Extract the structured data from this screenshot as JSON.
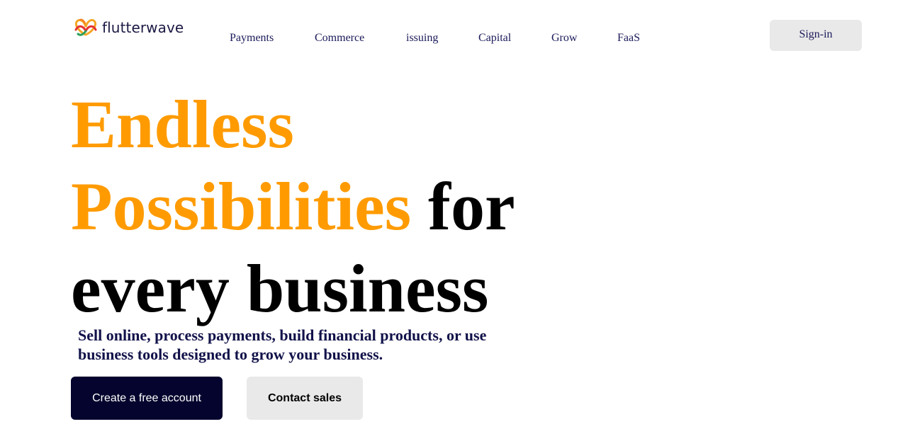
{
  "brand": {
    "name": "flutterwave",
    "logo_icon": "flutterwave-butterfly-logo",
    "colors": {
      "orange": "#ff9b00",
      "navy": "#04042e",
      "nav_text": "#1b1a5a",
      "light_button": "#e9e9e9"
    }
  },
  "nav": {
    "items": [
      {
        "label": "Payments"
      },
      {
        "label": "Commerce"
      },
      {
        "label": "issuing"
      },
      {
        "label": "Capital"
      },
      {
        "label": "Grow"
      },
      {
        "label": "FaaS"
      }
    ],
    "signin_label": "Sign-in"
  },
  "hero": {
    "line1": "Endless",
    "line2_highlight": "Possibilities",
    "line2_rest": "for",
    "line3": "every business",
    "subtitle": "Sell online, process payments, build financial products, or use business tools designed to grow your business."
  },
  "cta": {
    "primary_label": "Create a free account",
    "secondary_label": "Contact sales"
  }
}
